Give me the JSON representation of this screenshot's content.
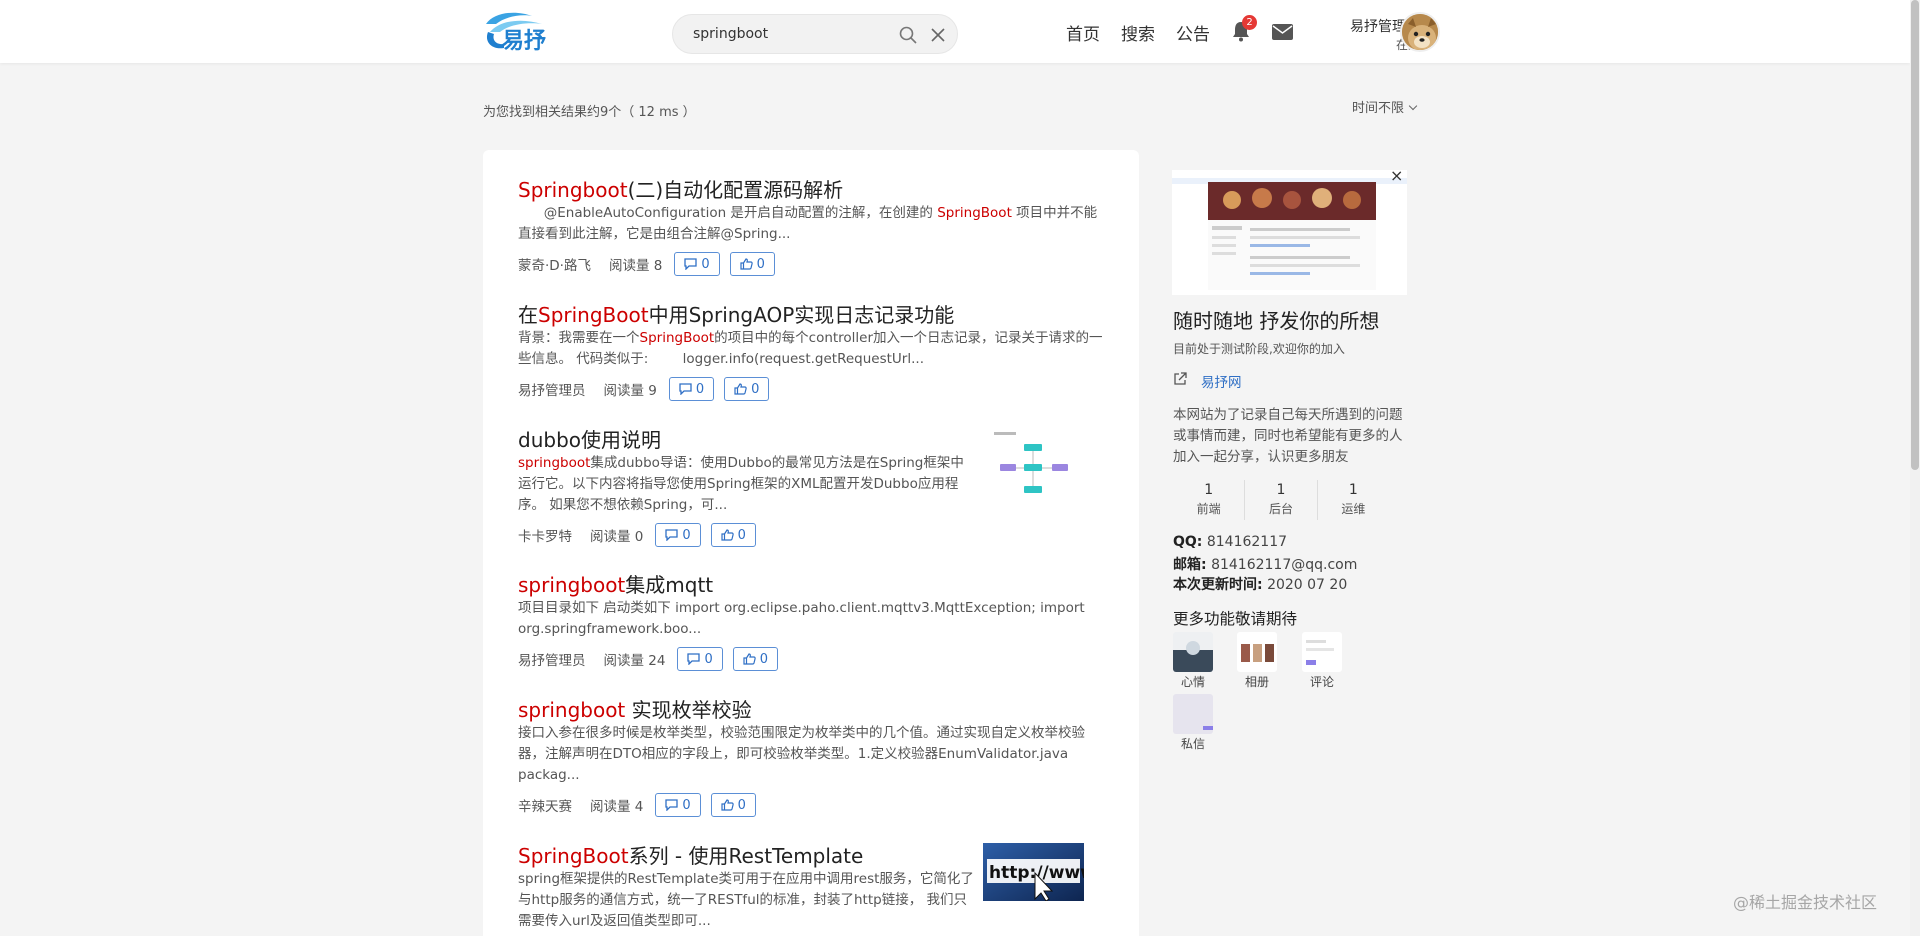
{
  "header": {
    "search_value": "springboot",
    "nav": [
      "首页",
      "搜索",
      "公告"
    ],
    "notification_count": "2",
    "user_name": "易抒管理员",
    "user_status": "在线"
  },
  "results_meta": {
    "count_text": "为您找到相关结果约9个（ 12 ms ）",
    "time_filter": "时间不限"
  },
  "results": [
    {
      "title_hl": "Springboot",
      "title_rest": "(二)自动化配置源码解析",
      "summary_pre": "      @EnableAutoConfiguration 是开启自动配置的注解，在创建的 ",
      "summary_hl": "SpringBoot",
      "summary_post": " 项目中并不能直接看到此注解，它是由组合注解@Spring...",
      "author": "蒙奇·D·路飞",
      "reads": "阅读量 8",
      "comments": "0",
      "likes": "0"
    },
    {
      "title_pre": "在",
      "title_hl": "SpringBoot",
      "title_rest": "中用SpringAOP实现日志记录功能",
      "summary_pre": "背景：我需要在一个",
      "summary_hl": "SpringBoot",
      "summary_post": "的项目中的每个controller加入一个日志记录，记录关于请求的一些信息。 代码类似于:        logger.info(request.getRequestUrl...",
      "author": "易抒管理员",
      "reads": "阅读量 9",
      "comments": "0",
      "likes": "0"
    },
    {
      "title_rest": "dubbo使用说明",
      "summary_hl": "springboot",
      "summary_post": "集成dubbo导语：使用Dubbo的最常见方法是在Spring框架中运行它。以下内容将指导您使用Spring框架的XML配置开发Dubbo应用程序。 如果您不想依赖Spring，可...",
      "author": "卡卡罗特",
      "reads": "阅读量 0",
      "comments": "0",
      "likes": "0"
    },
    {
      "title_hl": "springboot",
      "title_rest": "集成mqtt",
      "summary_post": "项目目录如下 启动类如下 import org.eclipse.paho.client.mqttv3.MqttException; import org.springframework.boo...",
      "author": "易抒管理员",
      "reads": "阅读量 24",
      "comments": "0",
      "likes": "0"
    },
    {
      "title_hl": "springboot",
      "title_rest": " 实现枚举校验",
      "summary_post": "接口入参在很多时候是枚举类型，校验范围限定为枚举类中的几个值。通过实现自定义枚举校验器，注解声明在DTO相应的字段上，即可校验枚举类型。1.定义校验器EnumValidator.java packag...",
      "author": "辛辣天赛",
      "reads": "阅读量 4",
      "comments": "0",
      "likes": "0"
    },
    {
      "title_hl": "SpringBoot",
      "title_rest": "系列 - 使用RestTemplate",
      "summary_post": "spring框架提供的RestTemplate类可用于在应用中调用rest服务，它简化了与http服务的通信方式，统一了RESTful的标准，封装了http链接， 我们只需要传入url及返回值类型即可...",
      "thumb_text": "http://www"
    }
  ],
  "sidebar": {
    "title": "随时随地 抒发你的所想",
    "subtitle": "目前处于测试阶段,欢迎你的加入",
    "link": "易抒网",
    "desc": "本网站为了记录自己每天所遇到的问题或事情而建，同时也希望能有更多的人加入一起分享，认识更多朋友",
    "stats": [
      {
        "n": "1",
        "l": "前端"
      },
      {
        "n": "1",
        "l": "后台"
      },
      {
        "n": "1",
        "l": "运维"
      }
    ],
    "qq_label": "QQ:",
    "qq": "814162117",
    "email_label": "邮箱:",
    "email": "814162117@qq.com",
    "update_label": "本次更新时间:",
    "update": "2020 07 20",
    "more_title": "更多功能敬请期待",
    "features": [
      "心情",
      "相册",
      "评论",
      "私信"
    ]
  },
  "watermark": "@稀土掘金技术社区",
  "colors": {
    "highlight": "#cc0000",
    "accent": "#2f6fc5"
  }
}
